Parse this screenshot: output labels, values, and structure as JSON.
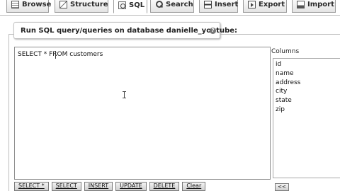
{
  "tabs": [
    {
      "label": "Browse",
      "icon": "browse-icon"
    },
    {
      "label": "Structure",
      "icon": "structure-icon"
    },
    {
      "label": "SQL",
      "icon": "sql-icon",
      "active": true
    },
    {
      "label": "Search",
      "icon": "search-icon"
    },
    {
      "label": "Insert",
      "icon": "insert-icon"
    },
    {
      "label": "Export",
      "icon": "export-icon"
    },
    {
      "label": "Import",
      "icon": "import-icon"
    }
  ],
  "header": {
    "title": "Run SQL query/queries on database danielle_youtube:",
    "help_icon": "help-icon"
  },
  "query": {
    "value": "SELECT * FROM customers"
  },
  "columns": {
    "label": "Columns",
    "items": [
      "id",
      "name",
      "address",
      "city",
      "state",
      "zip"
    ]
  },
  "buttons": {
    "select_star": "SELECT *",
    "select": "SELECT",
    "insert": "INSERT",
    "update": "UPDATE",
    "delete": "DELETE",
    "clear": "Clear",
    "move": "<<"
  }
}
